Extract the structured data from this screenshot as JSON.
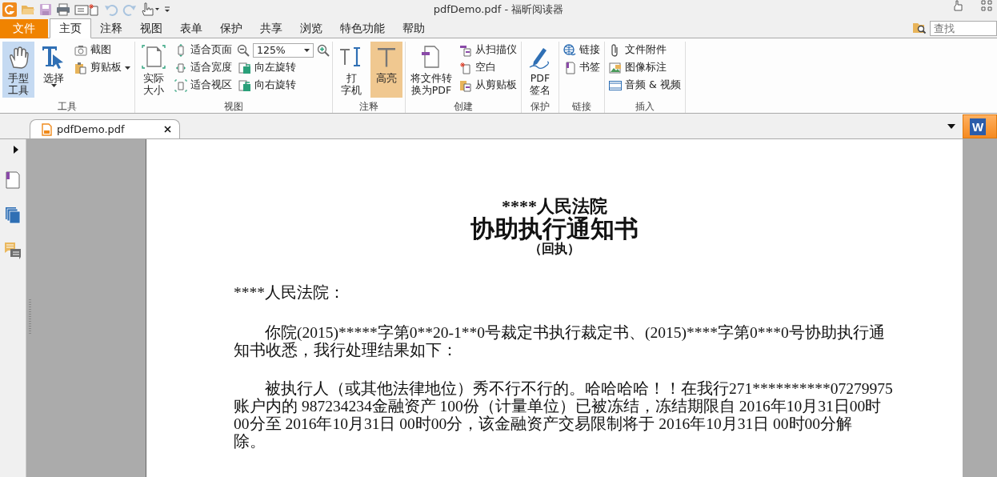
{
  "window": {
    "title": "pdfDemo.pdf - 福昕阅读器"
  },
  "menu_tabs": [
    {
      "label": "文件",
      "kind": "file",
      "selected": false
    },
    {
      "label": "主页",
      "kind": "tab",
      "selected": true
    },
    {
      "label": "注释",
      "kind": "tab",
      "selected": false
    },
    {
      "label": "视图",
      "kind": "tab",
      "selected": false
    },
    {
      "label": "表单",
      "kind": "tab",
      "selected": false
    },
    {
      "label": "保护",
      "kind": "tab",
      "selected": false
    },
    {
      "label": "共享",
      "kind": "tab",
      "selected": false
    },
    {
      "label": "浏览",
      "kind": "tab",
      "selected": false
    },
    {
      "label": "特色功能",
      "kind": "tab",
      "selected": false
    },
    {
      "label": "帮助",
      "kind": "tab",
      "selected": false
    }
  ],
  "search": {
    "placeholder": "查找"
  },
  "ribbon": {
    "groups": [
      {
        "title": "工具",
        "items": [
          {
            "kind": "large",
            "lines": [
              "手型",
              "工具"
            ],
            "selected": true,
            "dropdown": false
          },
          {
            "kind": "large",
            "lines": [
              "选择"
            ],
            "selected": false,
            "dropdown": true
          },
          {
            "kind": "small",
            "label": "截图",
            "dropdown": false
          },
          {
            "kind": "small",
            "label": "剪贴板",
            "dropdown": true
          }
        ]
      },
      {
        "title": "视图",
        "items": [
          {
            "kind": "large",
            "lines": [
              "实际",
              "大小"
            ],
            "selected": false,
            "dropdown": false
          },
          {
            "kind": "small",
            "label": "适合页面",
            "dropdown": false
          },
          {
            "kind": "small",
            "label": "适合宽度",
            "dropdown": false
          },
          {
            "kind": "small",
            "label": "适合视区",
            "dropdown": false
          },
          {
            "kind": "zoom",
            "value": "125%"
          },
          {
            "kind": "small",
            "label": "向左旋转",
            "dropdown": false
          },
          {
            "kind": "small",
            "label": "向右旋转",
            "dropdown": false
          }
        ]
      },
      {
        "title": "注释",
        "items": [
          {
            "kind": "large",
            "lines": [
              "打",
              "字机"
            ],
            "selected": false,
            "dropdown": false
          },
          {
            "kind": "large",
            "lines": [
              "高亮"
            ],
            "selected": true,
            "dropdown": false
          }
        ]
      },
      {
        "title": "创建",
        "items": [
          {
            "kind": "large",
            "lines": [
              "将文件转",
              "换为PDF"
            ],
            "selected": false,
            "dropdown": false
          },
          {
            "kind": "small",
            "label": "从扫描仪",
            "dropdown": false
          },
          {
            "kind": "small",
            "label": "空白",
            "dropdown": false
          },
          {
            "kind": "small",
            "label": "从剪贴板",
            "dropdown": false
          }
        ]
      },
      {
        "title": "保护",
        "items": [
          {
            "kind": "large",
            "lines": [
              "PDF",
              "签名"
            ],
            "selected": false,
            "dropdown": false
          }
        ]
      },
      {
        "title": "链接",
        "items": [
          {
            "kind": "small",
            "label": "链接",
            "dropdown": false
          },
          {
            "kind": "small",
            "label": "书签",
            "dropdown": false
          }
        ]
      },
      {
        "title": "插入",
        "items": [
          {
            "kind": "small",
            "label": "文件附件",
            "dropdown": false
          },
          {
            "kind": "small",
            "label": "图像标注",
            "dropdown": false
          },
          {
            "kind": "small",
            "label": "音频 & 视频",
            "dropdown": false
          }
        ]
      }
    ]
  },
  "document_tabs": [
    {
      "label": "pdfDemo.pdf",
      "selected": true
    }
  ],
  "word_button": {
    "letter": "W"
  },
  "document": {
    "court": "****人民法院",
    "title": "协助执行通知书",
    "subtitle": "（回执）",
    "salutation": "****人民法院：",
    "paragraphs": [
      {
        "lines": [
          "你院(2015)*****字第0**20-1**0号裁定书执行裁定书、(2015)****字第0***0号协助执行通",
          "知书收悉，我行处理结果如下："
        ]
      },
      {
        "lines": [
          "被执行人（或其他法律地位）秀不行不行的。哈哈哈哈！！在我行271**********07279975",
          "账户内的 987234234金融资产 100份（计量单位）已被冻结，冻结期限自 2016年10月31日00时",
          "00分至 2016年10月31日 00时00分，该金融资产交易限制将于 2016年10月31日 00时00分解",
          "除。"
        ]
      }
    ]
  }
}
